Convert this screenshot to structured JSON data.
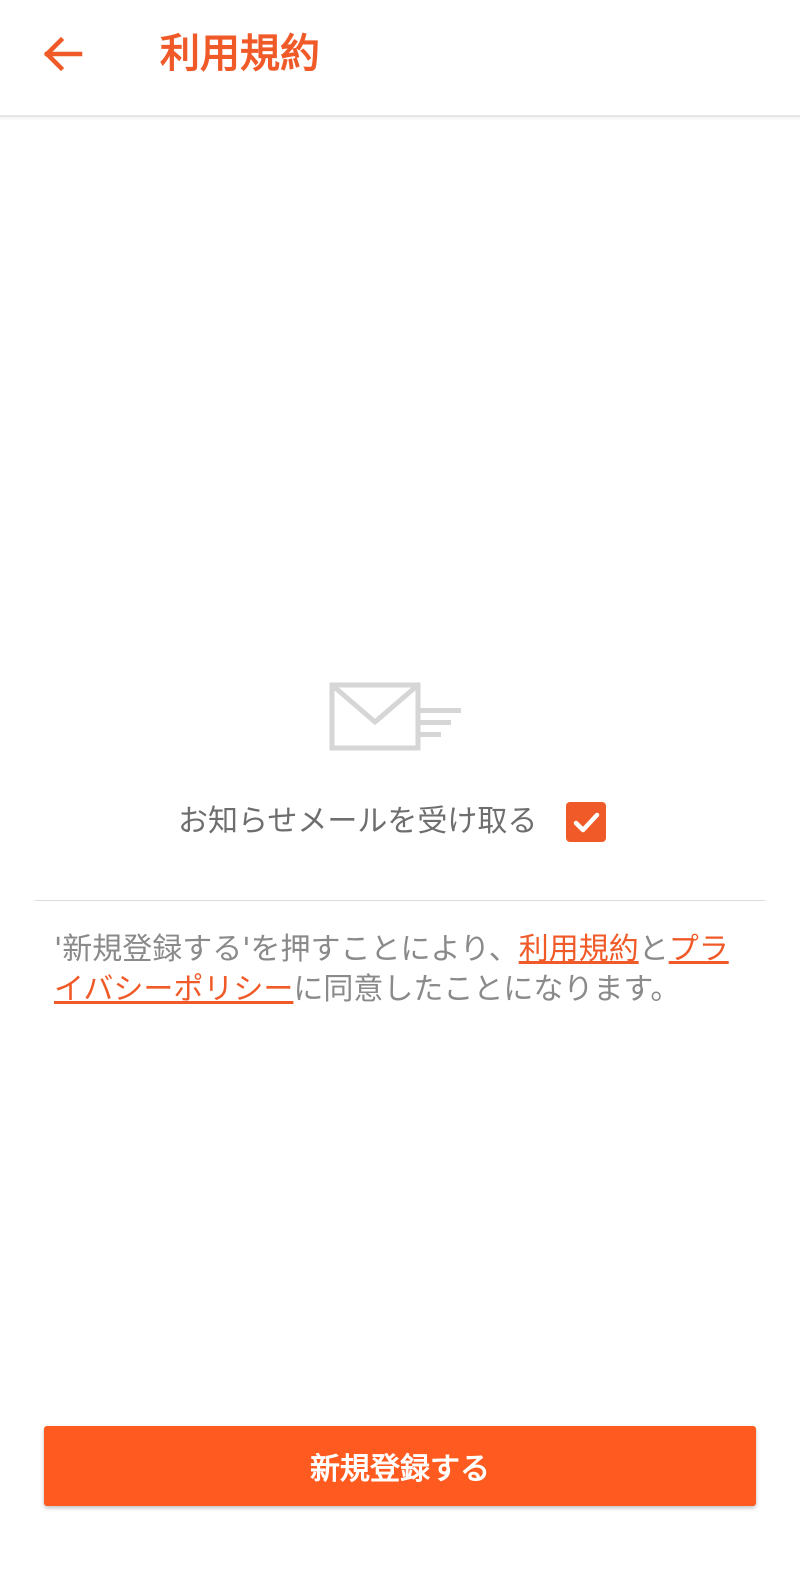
{
  "header": {
    "title": "利用規約",
    "back_icon": "arrow-left-icon"
  },
  "newsletter": {
    "icon": "envelope-sending-icon",
    "label": "お知らせメールを受け取る",
    "checked": true
  },
  "consent": {
    "prefix": "'新規登録する'を押すことにより、",
    "terms_link": "利用規約",
    "conjunction": "と",
    "privacy_link": "プライバシーポリシー",
    "suffix": "に同意したことになります。"
  },
  "register_button": {
    "label": "新規登録する"
  },
  "colors": {
    "accent": "#f05a28",
    "button": "#ff5a1f",
    "text_gray": "#6e6e6e",
    "icon_gray": "#d6d6d6"
  }
}
